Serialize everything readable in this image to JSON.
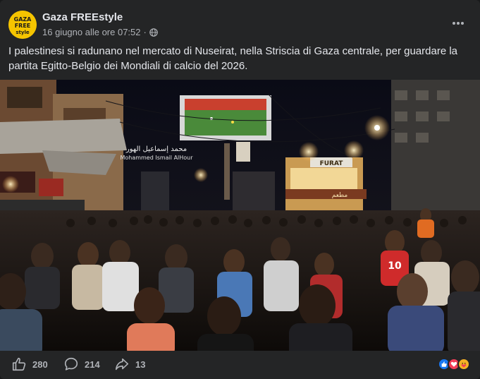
{
  "post": {
    "page_name": "Gaza FREEstyle",
    "timestamp": "16 giugno alle ore 07:52",
    "separator": "·",
    "audience_icon": "globe-icon",
    "text": "I palestinesi si radunano nel mercato di Nuseirat, nella Striscia di Gaza centrale, per guardare la partita Egitto-Belgio dei Mondiali di calcio del 2026."
  },
  "avatar": {
    "logo_text": "Gaza FREE style",
    "color": "#f5c400"
  },
  "photo": {
    "billboard_arabic": "محمد إسماعيل الهور",
    "billboard_latin": "Mohammed Ismail AlHour",
    "shop_sign": "FURAT",
    "shop_sign_arabic": "مطعم",
    "jersey_number": "10"
  },
  "footer": {
    "likes": "280",
    "comments": "214",
    "shares": "13"
  },
  "colors": {
    "card_bg": "#242526",
    "like_blue": "#1877f2",
    "love_red": "#f33e58",
    "haha_yellow": "#f7b125"
  }
}
